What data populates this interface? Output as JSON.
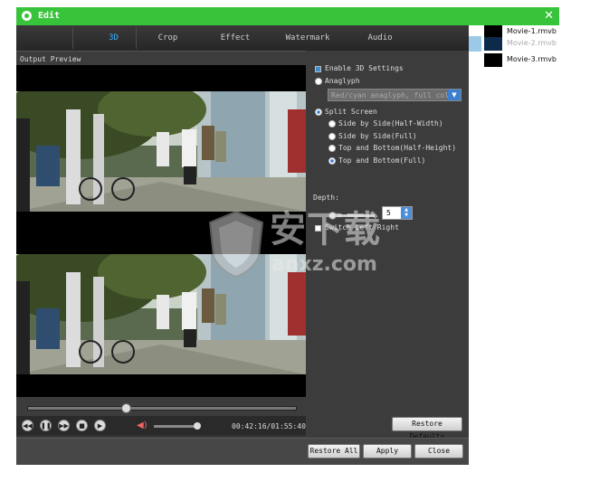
{
  "window": {
    "title": "Edit"
  },
  "tabs": [
    {
      "label": "3D",
      "active": true
    },
    {
      "label": "Crop",
      "active": false
    },
    {
      "label": "Effect",
      "active": false
    },
    {
      "label": "Watermark",
      "active": false
    },
    {
      "label": "Audio",
      "active": false
    }
  ],
  "preview": {
    "label": "Output Preview",
    "seek_fraction": 0.36,
    "volume_fraction": 0.95,
    "timecode": "00:42:16/01:55:40"
  },
  "settings": {
    "enable_3d": {
      "label": "Enable 3D Settings",
      "checked": true
    },
    "anaglyph": {
      "label": "Anaglyph",
      "selected": false,
      "select_value": "Red/cyan anaglyph, full color"
    },
    "split_screen": {
      "label": "Split Screen",
      "selected": true
    },
    "split_options": [
      {
        "label": "Side by Side(Half-Width)",
        "selected": false
      },
      {
        "label": "Side by Side(Full)",
        "selected": false
      },
      {
        "label": "Top and Bottom(Half-Height)",
        "selected": false
      },
      {
        "label": "Top and Bottom(Full)",
        "selected": true
      }
    ],
    "depth": {
      "label": "Depth:",
      "value": "5",
      "fraction": 0.0
    },
    "switch_left_right": {
      "label": "Switch Left Right",
      "checked": false
    },
    "restore_defaults": "Restore Defaults"
  },
  "buttons": {
    "restore_all": "Restore All",
    "apply": "Apply",
    "close": "Close"
  },
  "files": [
    {
      "name": "Movie-1.rmvb",
      "selected": false
    },
    {
      "name": "Movie-2.rmvb",
      "selected": true
    },
    {
      "name": "Movie-3.rmvb",
      "selected": false
    }
  ],
  "watermark": {
    "brand_cn": "安下载",
    "site": "anxz.com"
  },
  "colors": {
    "titlebar": "#37c43a",
    "accent": "#39b0ff",
    "panel": "#3c3c3c"
  }
}
